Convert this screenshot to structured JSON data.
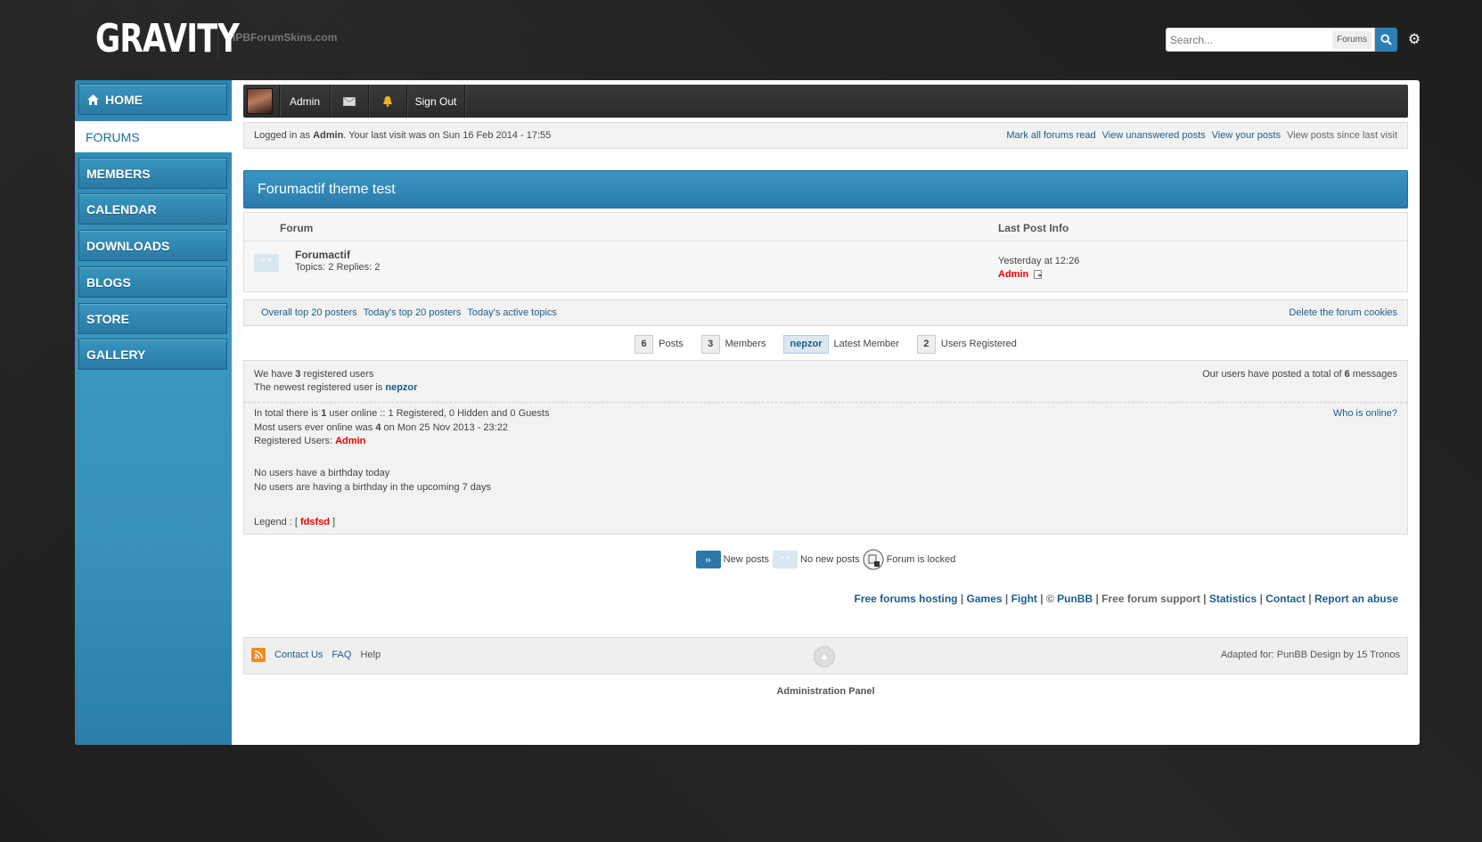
{
  "header": {
    "logo": "GRAVITY",
    "site_name": "IPBForumSkins.com",
    "search": {
      "placeholder": "Search...",
      "scope": "Forums"
    }
  },
  "sidebar": {
    "items": [
      {
        "label": "HOME",
        "active": false
      },
      {
        "label": "FORUMS",
        "active": true
      },
      {
        "label": "MEMBERS",
        "active": false
      },
      {
        "label": "CALENDAR",
        "active": false
      },
      {
        "label": "DOWNLOADS",
        "active": false
      },
      {
        "label": "BLOGS",
        "active": false
      },
      {
        "label": "STORE",
        "active": false
      },
      {
        "label": "GALLERY",
        "active": false
      }
    ]
  },
  "userbar": {
    "username": "Admin",
    "signout": "Sign Out"
  },
  "infobar": {
    "logged_prefix": "Logged in as ",
    "logged_user": "Admin",
    "last_visit": ". Your last visit was on Sun 16 Feb 2014 - 17:55",
    "links": [
      "Mark all forums read",
      "View unanswered posts",
      "View your posts"
    ],
    "plain_link": "View posts since last visit"
  },
  "category": {
    "title": "Forumactif theme test"
  },
  "forum_table": {
    "col_forum": "Forum",
    "col_lastpost": "Last Post Info",
    "rows": [
      {
        "name": "Forumactif",
        "stats": "Topics: 2 Replies: 2",
        "last_time": "Yesterday at 12:26",
        "last_user": "Admin"
      }
    ]
  },
  "links_bar": {
    "left": [
      "Overall top 20 posters",
      "Today's top 20 posters",
      "Today's active topics"
    ],
    "right": "Delete the forum cookies"
  },
  "stats": {
    "posts_count": "6",
    "posts_label": "Posts",
    "members_count": "3",
    "members_label": "Members",
    "latest_member": "nepzor",
    "latest_label": "Latest Member",
    "registered_count": "2",
    "registered_label": "Users Registered"
  },
  "whois": {
    "reg_pre": "We have ",
    "reg_num": "3",
    "reg_post": " registered users",
    "newest_pre": "The newest registered user is ",
    "newest_user": "nepzor",
    "total_pre": "Our users have posted a total of ",
    "total_num": "6",
    "total_post": " messages",
    "online_pre": "In total there is ",
    "online_num": "1",
    "online_post": " user online :: 1 Registered, 0 Hidden and 0 Guests",
    "most_pre": "Most users ever online was ",
    "most_num": "4",
    "most_post": " on Mon 25 Nov 2013 - 23:22",
    "regusers_pre": "Registered Users: ",
    "regusers_name": "Admin",
    "who_online": "Who is online?",
    "birthday_today": "No users have a birthday today",
    "birthday_upcoming": "No users are having a birthday in the upcoming 7 days",
    "legend_pre": "Legend :  [ ",
    "legend_name": "fdsfsd",
    "legend_post": " ]"
  },
  "legend": {
    "new_posts": "New posts",
    "no_new_posts": "No new posts",
    "locked": "Forum is locked"
  },
  "footer_links": {
    "hosting": "Free forums hosting",
    "games": "Games",
    "fight": "Fight",
    "copyright": "© ",
    "punbb": "PunBB",
    "support": "Free forum support",
    "statistics": "Statistics",
    "contact": "Contact",
    "abuse": "Report an abuse"
  },
  "bottombar": {
    "contact": "Contact Us",
    "faq": "FAQ",
    "help": "Help",
    "adapted": "Adapted for: PunBB Design by 15 Tronos"
  },
  "admin_panel": "Administration Panel",
  "colors": {
    "accent": "#2d7fb4",
    "sidebar": "#3590bb",
    "user_red": "#ee0000"
  }
}
